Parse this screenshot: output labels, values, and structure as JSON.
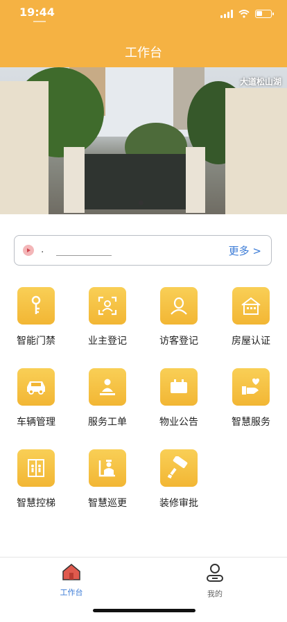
{
  "status_bar": {
    "time": "19:44"
  },
  "header": {
    "title": "工作台"
  },
  "banner": {
    "caption": "大道松山湖"
  },
  "notice": {
    "text": ".",
    "more_label": "更多 >"
  },
  "colors": {
    "header": "#f5b243",
    "tile_gold": "#f2b634",
    "link_blue": "#3b7bd6",
    "tab_active_red": "#e05a4e"
  },
  "grid": [
    {
      "label": "智能门禁",
      "icon": "key-icon"
    },
    {
      "label": "业主登记",
      "icon": "face-scan-icon"
    },
    {
      "label": "访客登记",
      "icon": "person-icon"
    },
    {
      "label": "房屋认证",
      "icon": "house-icon"
    },
    {
      "label": "车辆管理",
      "icon": "car-icon"
    },
    {
      "label": "服务工单",
      "icon": "service-person-icon"
    },
    {
      "label": "物业公告",
      "icon": "notice-board-icon"
    },
    {
      "label": "智慧服务",
      "icon": "heart-hand-icon"
    },
    {
      "label": "智慧控梯",
      "icon": "elevator-icon"
    },
    {
      "label": "智慧巡更",
      "icon": "guard-icon"
    },
    {
      "label": "装修审批",
      "icon": "paint-roller-icon"
    }
  ],
  "tabbar": {
    "items": [
      {
        "label": "工作台",
        "icon": "home-icon",
        "active": true
      },
      {
        "label": "我的",
        "icon": "profile-icon",
        "active": false
      }
    ]
  }
}
